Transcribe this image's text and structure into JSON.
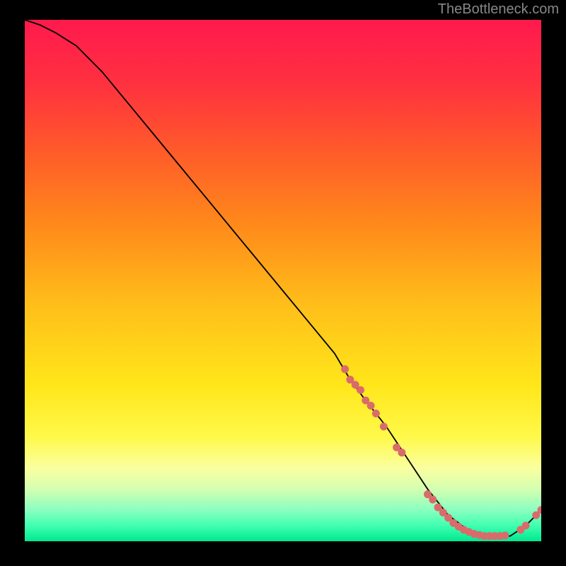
{
  "watermark": "TheBottleneck.com",
  "chart_data": {
    "type": "line",
    "title": "",
    "xlabel": "",
    "ylabel": "",
    "xlim": [
      0,
      100
    ],
    "ylim": [
      0,
      100
    ],
    "series": [
      {
        "name": "bottleneck-curve",
        "x": [
          0,
          3,
          6,
          10,
          15,
          20,
          25,
          30,
          35,
          40,
          45,
          50,
          55,
          60,
          63,
          66,
          70,
          74,
          78,
          82,
          86,
          90,
          94,
          97,
          100
        ],
        "values": [
          100,
          99,
          97.5,
          95,
          90,
          84,
          78,
          72,
          66,
          60,
          54,
          48,
          42,
          36,
          31,
          27,
          22,
          16,
          10,
          5,
          2,
          1,
          1,
          3,
          6
        ]
      }
    ],
    "point_clusters": [
      {
        "name": "upper-slope-points",
        "color": "#d96b6b",
        "points": [
          {
            "x": 62,
            "y": 33
          },
          {
            "x": 63,
            "y": 31
          },
          {
            "x": 64,
            "y": 30
          },
          {
            "x": 65,
            "y": 29
          },
          {
            "x": 66,
            "y": 27
          },
          {
            "x": 67,
            "y": 26
          },
          {
            "x": 68,
            "y": 24.5
          },
          {
            "x": 69.5,
            "y": 22
          },
          {
            "x": 72,
            "y": 18
          },
          {
            "x": 73,
            "y": 17
          }
        ]
      },
      {
        "name": "valley-floor-points",
        "color": "#d96b6b",
        "points": [
          {
            "x": 78,
            "y": 9
          },
          {
            "x": 79,
            "y": 8
          },
          {
            "x": 80,
            "y": 6.5
          },
          {
            "x": 81,
            "y": 5.5
          },
          {
            "x": 82,
            "y": 4.5
          },
          {
            "x": 83,
            "y": 3.5
          },
          {
            "x": 84,
            "y": 2.8
          },
          {
            "x": 85,
            "y": 2.2
          },
          {
            "x": 86,
            "y": 1.8
          },
          {
            "x": 87,
            "y": 1.4
          },
          {
            "x": 88,
            "y": 1.2
          },
          {
            "x": 89,
            "y": 1.0
          },
          {
            "x": 90,
            "y": 1.0
          },
          {
            "x": 91,
            "y": 1.0
          },
          {
            "x": 92,
            "y": 1.0
          },
          {
            "x": 93,
            "y": 1.1
          }
        ]
      },
      {
        "name": "right-rise-points",
        "color": "#d96b6b",
        "points": [
          {
            "x": 96,
            "y": 2.2
          },
          {
            "x": 97,
            "y": 3
          },
          {
            "x": 99,
            "y": 5
          },
          {
            "x": 100,
            "y": 6
          }
        ]
      }
    ],
    "gradient_stops": [
      {
        "offset": 0,
        "color": "#ff1a4d"
      },
      {
        "offset": 0.12,
        "color": "#ff3040"
      },
      {
        "offset": 0.25,
        "color": "#ff5a2a"
      },
      {
        "offset": 0.4,
        "color": "#ff8c1a"
      },
      {
        "offset": 0.55,
        "color": "#ffbf1a"
      },
      {
        "offset": 0.7,
        "color": "#ffe61a"
      },
      {
        "offset": 0.8,
        "color": "#fff94a"
      },
      {
        "offset": 0.86,
        "color": "#faffa0"
      },
      {
        "offset": 0.9,
        "color": "#d4ffb0"
      },
      {
        "offset": 0.94,
        "color": "#8affc0"
      },
      {
        "offset": 0.97,
        "color": "#40ffb0"
      },
      {
        "offset": 1.0,
        "color": "#00e890"
      }
    ]
  }
}
